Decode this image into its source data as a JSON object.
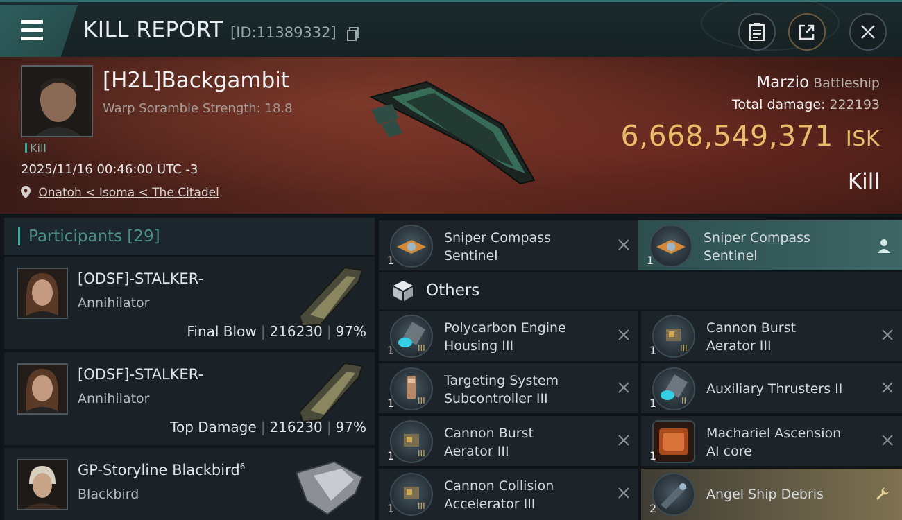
{
  "header": {
    "title": "KILL REPORT",
    "report_id": "[ID:11389332]"
  },
  "victim": {
    "name": "[H2L]Backgambit",
    "stat": "Warp Soramble Strength: 18.8",
    "tag": "Kill",
    "datetime": "2025/11/16 00:46:00 UTC -3",
    "location": "Onatoh < Isoma < The Citadel",
    "ship_name": "Marzio",
    "ship_class": "Battleship",
    "total_damage_label": "Total damage:",
    "total_damage": "222193",
    "isk_value": "6,668,549,371",
    "isk_unit": "ISK",
    "result": "Kill"
  },
  "participants": {
    "label": "Participants",
    "count": "[29]",
    "rows": [
      {
        "name": "[ODSF]-STALKER-",
        "ship": "Annihilator",
        "role": "Final Blow",
        "damage": "216230",
        "percent": "97%"
      },
      {
        "name": "[ODSF]-STALKER-",
        "ship": "Annihilator",
        "role": "Top Damage",
        "damage": "216230",
        "percent": "97%"
      },
      {
        "name": "GP-Storyline Blackbird",
        "sup": "6",
        "ship": "Blackbird"
      }
    ]
  },
  "items": {
    "top_left": {
      "name1": "Sniper Compass",
      "name2": "Sentinel",
      "qty": "1"
    },
    "top_right": {
      "name1": "Sniper Compass",
      "name2": "Sentinel",
      "qty": "1"
    },
    "category": "Others",
    "list": [
      {
        "name1": "Polycarbon Engine",
        "name2": "Housing III",
        "qty": "1",
        "tier": "III"
      },
      {
        "name1": "Cannon Burst",
        "name2": "Aerator III",
        "qty": "1",
        "tier": "III"
      },
      {
        "name1": "Targeting System",
        "name2": "Subcontroller III",
        "qty": "1",
        "tier": "III"
      },
      {
        "name1": "Auxiliary Thrusters II",
        "name2": "",
        "qty": "1",
        "tier": "II"
      },
      {
        "name1": "Cannon Burst",
        "name2": "Aerator III",
        "qty": "1",
        "tier": "III"
      },
      {
        "name1": "Machariel Ascension",
        "name2": "AI core",
        "qty": "1",
        "tier": ""
      },
      {
        "name1": "Cannon Collision",
        "name2": "Accelerator III",
        "qty": "1",
        "tier": "III"
      },
      {
        "name1": "Angel Ship Debris",
        "name2": "",
        "qty": "2",
        "tier": ""
      }
    ]
  },
  "colors": {
    "accent": "#4aa6a0",
    "isk_gold": "#e8bc6b",
    "banner_red": "#5a281f"
  }
}
